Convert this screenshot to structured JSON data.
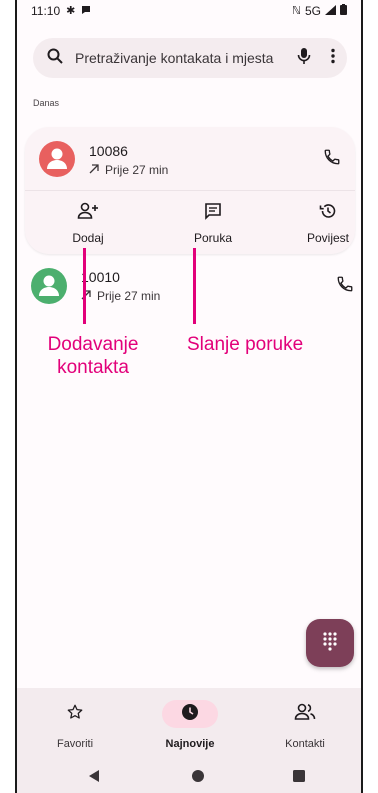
{
  "status_bar": {
    "time": "11:10",
    "network": "5G"
  },
  "search": {
    "placeholder": "Pretraživanje kontakata i mjesta"
  },
  "section": {
    "label": "Danas"
  },
  "calls": [
    {
      "name": "10086",
      "time": "Prije 27 min",
      "avatar_color": "#e8605f",
      "expanded": true
    },
    {
      "name": "10010",
      "time": "Prije 27 min",
      "avatar_color": "#4caf6e",
      "expanded": false
    }
  ],
  "actions": {
    "add_label": "Dodaj",
    "message_label": "Poruka",
    "history_label": "Povijest"
  },
  "annotations": {
    "add_contact_line1": "Dodavanje",
    "add_contact_line2": "kontakta",
    "send_message": "Slanje poruke"
  },
  "nav": {
    "favorites_label": "Favoriti",
    "recents_label": "Najnovije",
    "contacts_label": "Kontakti",
    "active": "recents"
  },
  "colors": {
    "accent": "#7d3f58",
    "annotation": "#e2007a",
    "active_nav_pill": "#fcd8e3"
  }
}
